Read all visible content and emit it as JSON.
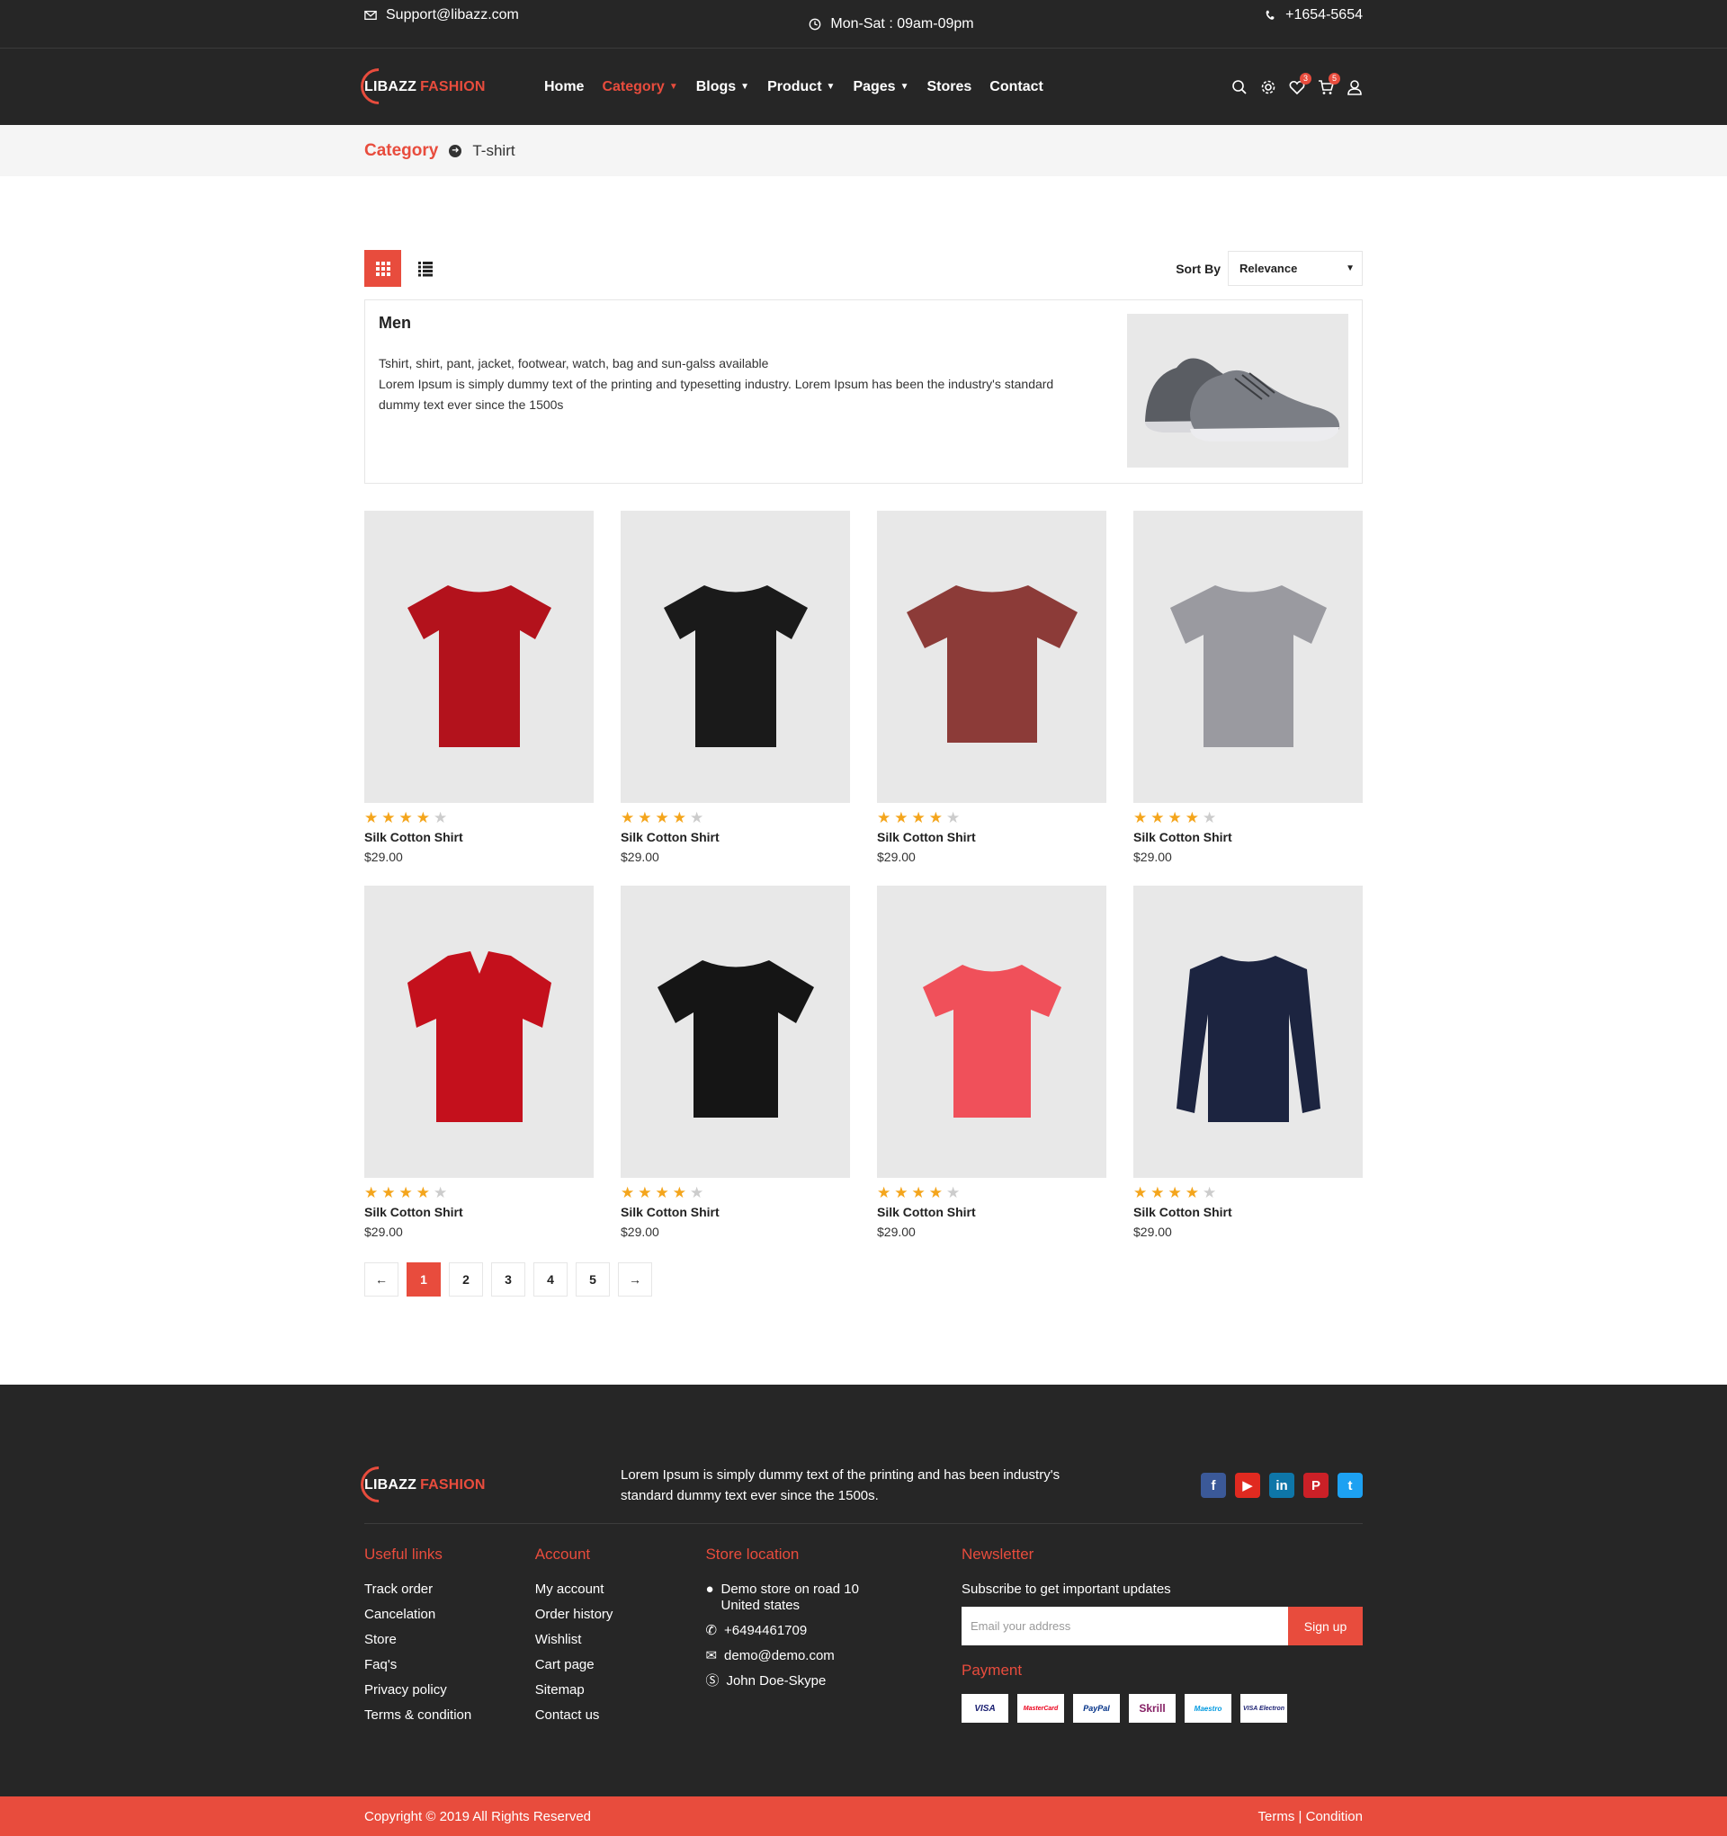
{
  "topbar": {
    "email": "Support@libazz.com",
    "hours": "Mon-Sat : 09am-09pm",
    "phone": "+1654-5654"
  },
  "brand": {
    "part1": "LIBAZZ",
    "part2": "FASHION"
  },
  "nav": {
    "items": [
      {
        "label": "Home"
      },
      {
        "label": "Category"
      },
      {
        "label": "Blogs"
      },
      {
        "label": "Product"
      },
      {
        "label": "Pages"
      },
      {
        "label": "Stores"
      },
      {
        "label": "Contact"
      }
    ],
    "wishlist_count": "3",
    "cart_count": "5"
  },
  "breadcrumb": {
    "parent": "Category",
    "current": "T-shirt"
  },
  "toolbar": {
    "sort_label": "Sort By",
    "sort_value": "Relevance"
  },
  "category": {
    "title": "Men",
    "line1": "Tshirt, shirt, pant, jacket, footwear, watch, bag and sun-galss available",
    "line2": "Lorem Ipsum is simply dummy text of the printing and typesetting industry. Lorem Ipsum has been the industry's standard dummy text ever since the 1500s"
  },
  "products": [
    {
      "name": "Silk Cotton Shirt",
      "price": "$29.00",
      "rating": 4,
      "color": "#b3121c"
    },
    {
      "name": "Silk Cotton Shirt",
      "price": "$29.00",
      "rating": 4,
      "color": "#1a1a1a"
    },
    {
      "name": "Silk Cotton Shirt",
      "price": "$29.00",
      "rating": 4,
      "color": "#8c3b38"
    },
    {
      "name": "Silk Cotton Shirt",
      "price": "$29.00",
      "rating": 4,
      "color": "#9a9aa0"
    },
    {
      "name": "Silk Cotton Shirt",
      "price": "$29.00",
      "rating": 4,
      "color": "#c4101c"
    },
    {
      "name": "Silk Cotton Shirt",
      "price": "$29.00",
      "rating": 4,
      "color": "#151515"
    },
    {
      "name": "Silk Cotton Shirt",
      "price": "$29.00",
      "rating": 4,
      "color": "#f0505a"
    },
    {
      "name": "Silk Cotton Shirt",
      "price": "$29.00",
      "rating": 4,
      "color": "#1c2440"
    }
  ],
  "pagination": {
    "prev": "←",
    "pages": [
      "1",
      "2",
      "3",
      "4",
      "5"
    ],
    "current": "1",
    "next": "→"
  },
  "footer": {
    "blurb": "Lorem Ipsum is simply dummy text of the printing and has been industry's standard dummy text ever since the 1500s.",
    "useful_links": {
      "title": "Useful links",
      "items": [
        "Track order",
        "Cancelation",
        "Store",
        "Faq's",
        "Privacy policy",
        "Terms & condition"
      ]
    },
    "account": {
      "title": "Account",
      "items": [
        "My account",
        "Order history",
        "Wishlist",
        "Cart page",
        "Sitemap",
        "Contact us"
      ]
    },
    "store": {
      "title": "Store location",
      "address1": "Demo store on road 10",
      "address2": "United states",
      "phone": "+6494461709",
      "email": "demo@demo.com",
      "skype": "John Doe-Skype"
    },
    "newsletter": {
      "title": "Newsletter",
      "subtitle": "Subscribe to get important updates",
      "placeholder": "Email your address",
      "button": "Sign up"
    },
    "payment": {
      "title": "Payment",
      "methods": [
        "VISA",
        "MasterCard",
        "PayPal",
        "Skrill",
        "Maestro",
        "VISA Electron"
      ]
    }
  },
  "copyright": {
    "text": "Copyright © 2019 All Rights Reserved",
    "links": "Terms | Condition"
  },
  "colors": {
    "accent": "#e84c3d",
    "dark": "#262626",
    "star": "#f4a51c"
  }
}
